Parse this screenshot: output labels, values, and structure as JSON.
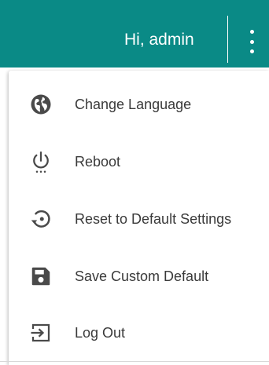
{
  "header": {
    "greeting": "Hi, admin",
    "accent_color": "#0a8a86",
    "more_icon": "more-vertical-icon"
  },
  "menu": {
    "items": [
      {
        "label": "Change Language",
        "icon": "globe-icon"
      },
      {
        "label": "Reboot",
        "icon": "power-icon"
      },
      {
        "label": "Reset to Default Settings",
        "icon": "reset-icon"
      },
      {
        "label": "Save Custom Default",
        "icon": "save-icon"
      },
      {
        "label": "Log Out",
        "icon": "logout-icon"
      }
    ]
  }
}
